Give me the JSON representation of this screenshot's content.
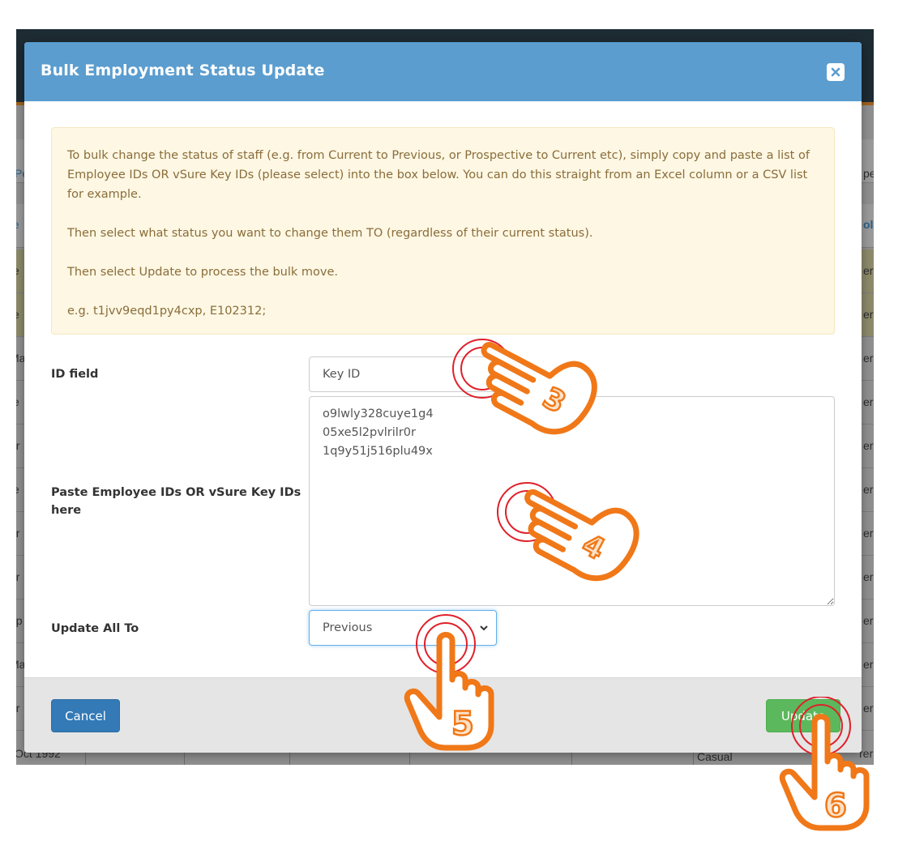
{
  "background": {
    "left_column": [
      "Pe",
      "e",
      "e",
      "e",
      "Ma",
      "e",
      "ar",
      "e",
      "ur",
      "ur",
      "ap",
      "Ma",
      "ur",
      "Oct 1992"
    ],
    "right_column": [
      "pe",
      "olo",
      "er",
      "er",
      "er",
      "er",
      "er",
      "er",
      "er",
      "er",
      "er",
      "er",
      "er",
      "rer"
    ],
    "bottom_row_type": "Casual"
  },
  "modal": {
    "title": "Bulk Employment Status Update",
    "close_label": "close",
    "info": {
      "paragraph1": "To bulk change the status of staff (e.g. from Current to Previous, or Prospective to Current etc), simply copy and paste a list of Employee IDs OR vSure Key IDs (please select) into the box below. You can do this straight from an Excel column or a CSV list for example.",
      "paragraph2": "Then select what status you want to change them TO (regardless of their current status).",
      "paragraph3": "Then select Update to process the bulk move.",
      "paragraph4": "e.g. t1jvv9eqd1py4cxp, E102312;"
    },
    "id_field": {
      "label": "ID field",
      "value": "Key ID"
    },
    "paste_field": {
      "label": "Paste Employee IDs OR vSure Key IDs here",
      "value": "o9lwly328cuye1g4\n05xe5l2pvlrilr0r\n1q9y51j516plu49x"
    },
    "update_all": {
      "label": "Update All To",
      "selected": "Previous"
    },
    "footer": {
      "cancel_label": "Cancel",
      "update_label": "Update"
    }
  },
  "tutorial_steps": [
    "3",
    "4",
    "5",
    "6"
  ],
  "colors": {
    "header": "#5b9dcf",
    "alert_bg": "#fdf7e3",
    "alert_text": "#8a6d3b",
    "cancel": "#337ab7",
    "update": "#5cb85c",
    "hand": "#f07818",
    "ring": "#e0202b"
  }
}
